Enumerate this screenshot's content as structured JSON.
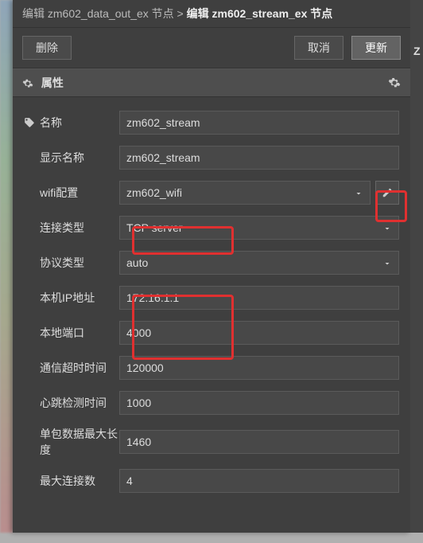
{
  "breadcrumb": {
    "prev_prefix": "编辑 ",
    "prev_name": "zm602_data_out_ex",
    "prev_suffix": " 节点",
    "sep": " > ",
    "curr_prefix": "编辑 ",
    "curr_name": "zm602_stream_ex",
    "curr_suffix": " 节点"
  },
  "toolbar": {
    "delete": "删除",
    "cancel": "取消",
    "update": "更新"
  },
  "section": {
    "title": "属性"
  },
  "form": {
    "name": {
      "label": "名称",
      "value": "zm602_stream"
    },
    "display": {
      "label": "显示名称",
      "value": "zm602_stream"
    },
    "wifi": {
      "label": "wifi配置",
      "value": "zm602_wifi"
    },
    "conn_type": {
      "label": "连接类型",
      "value": "TCP server"
    },
    "proto": {
      "label": "协议类型",
      "value": "auto"
    },
    "ip": {
      "label": "本机IP地址",
      "value": "172.16.1.1"
    },
    "port": {
      "label": "本地端口",
      "value": "4000"
    },
    "timeout": {
      "label": "通信超时时间",
      "value": "120000"
    },
    "heartbeat": {
      "label": "心跳检测时间",
      "value": "1000"
    },
    "pkt_max": {
      "label": "单包数据最大长度",
      "value": "1460"
    },
    "max_conn": {
      "label": "最大连接数",
      "value": "4"
    }
  },
  "right_letter": "Z"
}
